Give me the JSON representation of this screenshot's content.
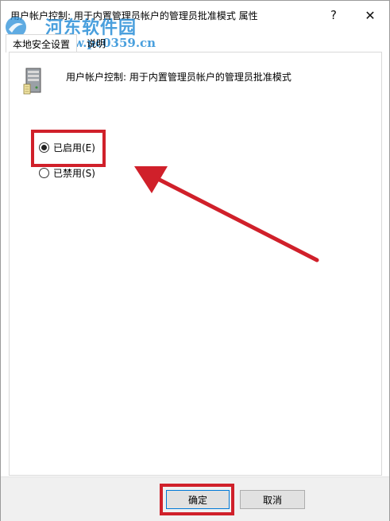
{
  "window": {
    "title": "用户帐户控制: 用于内置管理员帐户的管理员批准模式 属性",
    "help_glyph": "?",
    "close_glyph": "✕"
  },
  "watermark": {
    "name": "河东软件园",
    "url": "www.pc0359.cn"
  },
  "tabs": [
    {
      "label": "本地安全设置",
      "active": true
    },
    {
      "label": "说明",
      "active": false
    }
  ],
  "policy": {
    "icon": "server-icon",
    "name": "用户帐户控制: 用于内置管理员帐户的管理员批准模式"
  },
  "options": {
    "enabled": {
      "label": "已启用(E)",
      "checked": true
    },
    "disabled": {
      "label": "已禁用(S)",
      "checked": false
    }
  },
  "buttons": {
    "ok": "确定",
    "cancel": "取消"
  },
  "annotation": {
    "color": "#d0202a"
  }
}
